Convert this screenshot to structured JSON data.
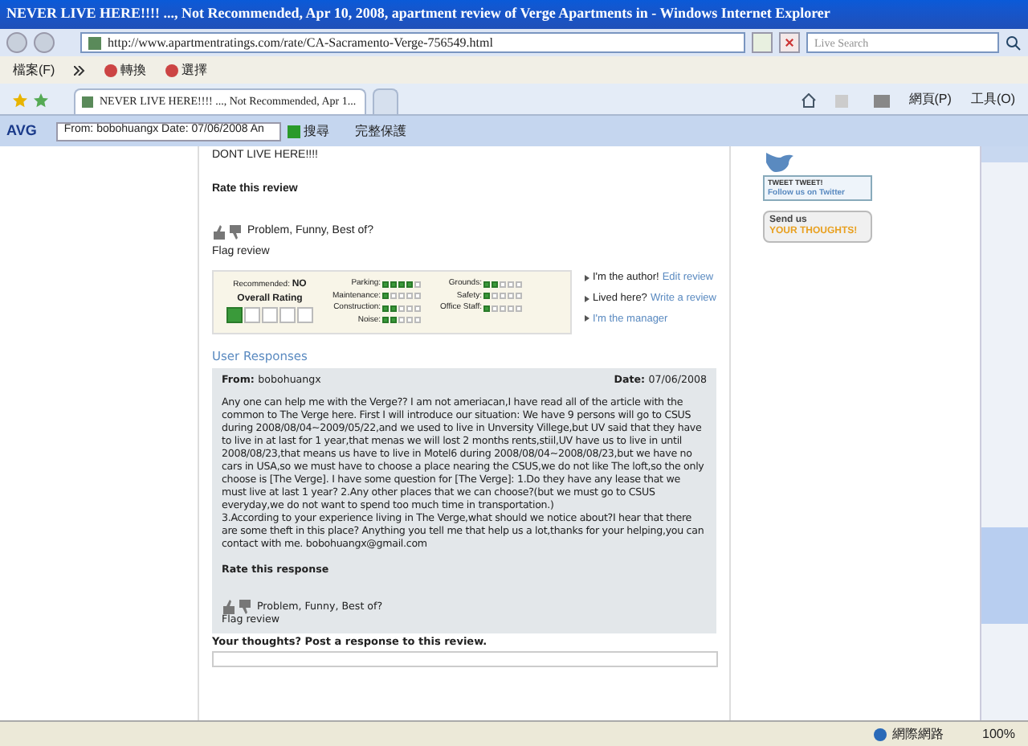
{
  "window": {
    "title": "NEVER LIVE HERE!!!! ..., Not Recommended, Apr 10, 2008, apartment review of Verge Apartments in - Windows Internet Explorer"
  },
  "address_bar": {
    "url": "http://www.apartmentratings.com/rate/CA-Sacramento-Verge-756549.html",
    "search_placeholder": "Live Search"
  },
  "menu": {
    "items": [
      "檔案(F)"
    ],
    "links": [
      "轉換",
      "選擇"
    ]
  },
  "tabs": [
    {
      "label": "NEVER LIVE HERE!!!! ..., Not Recommended, Apr 1...",
      "selected": true
    },
    {
      "selected": false
    }
  ],
  "command_bar": [
    "網頁(P)",
    "工具(O)"
  ],
  "avg_toolbar": {
    "brand": "AVG",
    "search_value": "From: bobohuangx Date: 07/06/2008  An",
    "search_button": "搜尋",
    "safe_label": "完整保護"
  },
  "review": {
    "body": "DONT LIVE HERE!!!!",
    "rate_label": "Rate this review",
    "feedback": "Problem, Funny, Best of?",
    "flag": "Flag review",
    "recommended_label": "Recommended:",
    "recommended_value": "NO",
    "overall_label": "Overall Rating",
    "overall": {
      "stars": 1
    },
    "ratings_left": [
      {
        "label": "Parking:",
        "stars": 4
      },
      {
        "label": "Maintenance:",
        "stars": 1
      },
      {
        "label": "Construction:",
        "stars": 2
      },
      {
        "label": "Noise:",
        "stars": 2
      }
    ],
    "ratings_right": [
      {
        "label": "Grounds:",
        "stars": 2
      },
      {
        "label": "Safety:",
        "stars": 1
      },
      {
        "label": "Office Staff:",
        "stars": 1
      }
    ],
    "links": [
      {
        "text": "I'm the author!",
        "link": "Edit review"
      },
      {
        "text": "Lived here?",
        "link": "Write a review"
      },
      {
        "link": "I'm the manager"
      }
    ]
  },
  "responses": {
    "heading": "User Responses",
    "from_label": "From:",
    "from": "bobohuangx",
    "date_label": "Date:",
    "date": "07/06/2008",
    "body": "Any one can help me with the Verge?? I am not ameriacan,I have read all of the article with the common to The Verge here. First I will introduce our situation: We have 9 persons will go to CSUS during 2008/08/04~2009/05/22,and we used to live in Unversity Villege,but UV said that they have to live in at last for 1 year,that menas we will lost 2 months rents,stiil,UV have us to live in until 2008/08/23,that means us have to live in Motel6 during 2008/08/04~2008/08/23,but we have no cars in USA,so we must have to choose a place nearing the CSUS,we do not like The loft,so the only choose is [The Verge]. I have some question for [The Verge]: 1.Do they have any lease that we must live at last 1 year? 2.Any other places that we can choose?(but we must go to CSUS everyday,we do not want to spend too much time in transportation.)\n3.According to your experience living in The Verge,what should we notice about?I hear that there are some theft in this place? Anything you tell me that help us a lot,thanks for your helping,you can contact with me. bobohuangx@gmail.com",
    "rate_label": "Rate this response",
    "feedback": "Problem, Funny, Best of?",
    "flag": "Flag review",
    "post_prompt": "Your thoughts? Post a response to this review."
  },
  "sidebar": {
    "twitter_title": "TWEET TWEET!",
    "twitter_link": "Follow us on Twitter",
    "send_title": "Send us",
    "send_highlight": "YOUR THOUGHTS!"
  },
  "status_bar": {
    "zone": "網際網路",
    "zoom": "100%"
  }
}
